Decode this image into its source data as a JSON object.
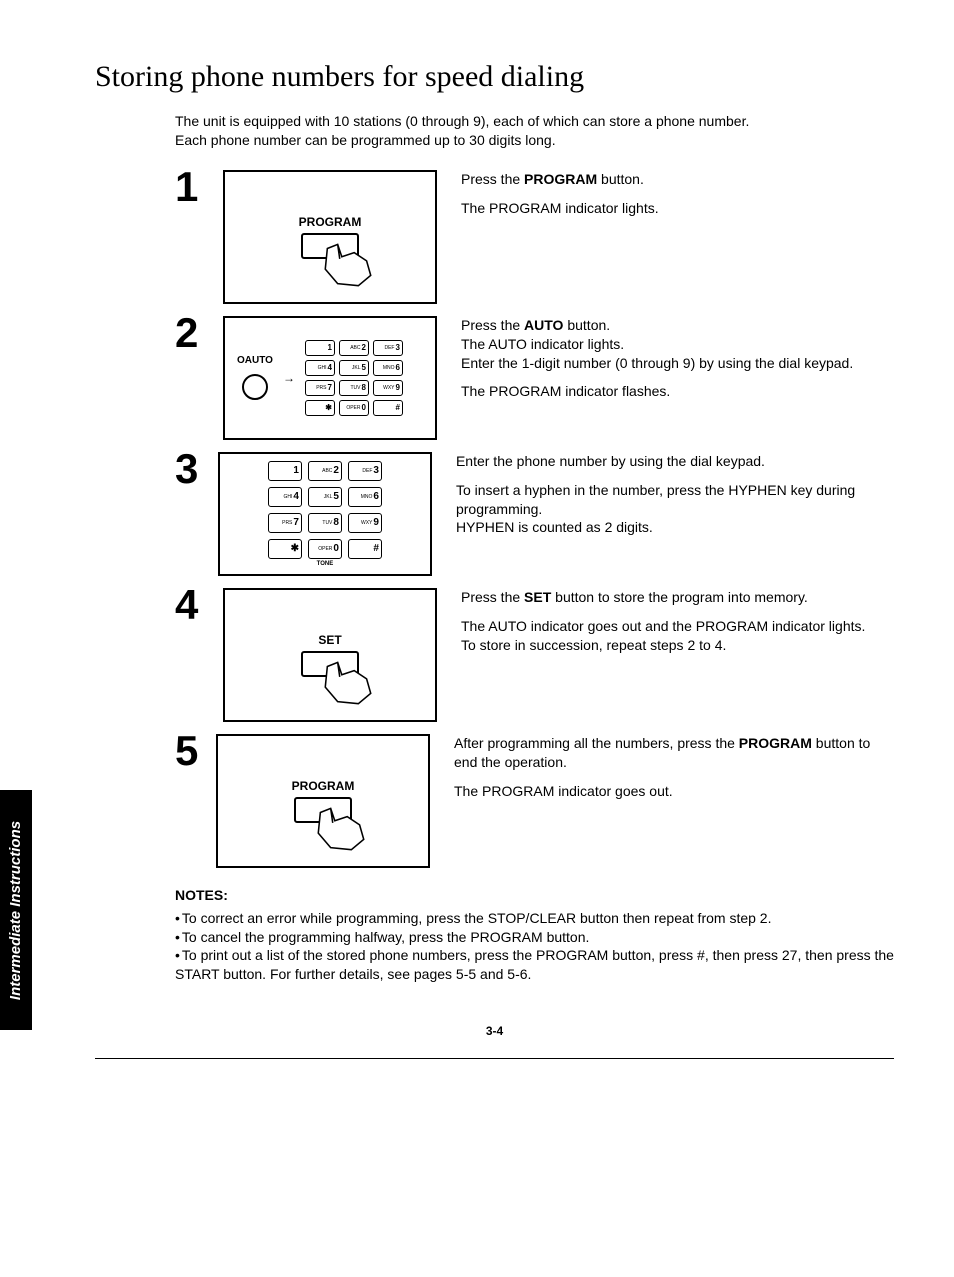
{
  "title": "Storing phone numbers for speed dialing",
  "intro_line1": "The unit is equipped with 10 stations (0 through 9), each of which can store a phone number.",
  "intro_line2": "Each phone number can be programmed up to 30 digits long.",
  "side_tab": "Intermediate Instructions",
  "page_number": "3-4",
  "steps": {
    "1": {
      "num": "1",
      "fig_label": "PROGRAM",
      "line1a": "Press the ",
      "line1b": "PROGRAM",
      "line1c": " button.",
      "line2": "The PROGRAM indicator lights."
    },
    "2": {
      "num": "2",
      "auto_label": "OAUTO",
      "line1a": "Press the ",
      "line1b": "AUTO",
      "line1c": " button.",
      "line2": "The AUTO indicator lights.",
      "line3": "Enter the 1-digit number (0 through 9) by using the dial keypad.",
      "line4": "The PROGRAM indicator flashes."
    },
    "3": {
      "num": "3",
      "tone": "TONE",
      "line1": "Enter the phone number by using the dial keypad.",
      "line2": "To insert a hyphen in the number, press the HYPHEN key during programming.",
      "line3": "HYPHEN is counted as 2 digits."
    },
    "4": {
      "num": "4",
      "fig_label": "SET",
      "line1a": "Press the ",
      "line1b": "SET",
      "line1c": " button to store the program into memory.",
      "line2": "The AUTO indicator goes out and the PROGRAM indicator lights.",
      "line3": "To store in succession, repeat steps 2 to 4."
    },
    "5": {
      "num": "5",
      "fig_label": "PROGRAM",
      "line1a": "After programming all the numbers, press the ",
      "line1b": "PROGRAM",
      "line1c": " button to end the operation.",
      "line2": "The PROGRAM indicator goes out."
    }
  },
  "keypad": {
    "k1": {
      "sub": "",
      "d": "1"
    },
    "k2": {
      "sub": "ABC",
      "d": "2"
    },
    "k3": {
      "sub": "DEF",
      "d": "3"
    },
    "k4": {
      "sub": "GHI",
      "d": "4"
    },
    "k5": {
      "sub": "JKL",
      "d": "5"
    },
    "k6": {
      "sub": "MNO",
      "d": "6"
    },
    "k7": {
      "sub": "PRS",
      "d": "7"
    },
    "k8": {
      "sub": "TUV",
      "d": "8"
    },
    "k9": {
      "sub": "WXY",
      "d": "9"
    },
    "ks": {
      "sub": "",
      "d": "✱"
    },
    "k0": {
      "sub": "OPER",
      "d": "0"
    },
    "kh": {
      "sub": "",
      "d": "#"
    }
  },
  "notes": {
    "heading": "NOTES:",
    "n1": "To correct an error while programming, press the STOP/CLEAR button then repeat from step 2.",
    "n2": "To cancel the programming halfway, press the PROGRAM button.",
    "n3": "To print out a list of the stored phone numbers, press the PROGRAM button, press #, then press 27, then press the START button. For further details, see pages 5-5 and 5-6."
  }
}
